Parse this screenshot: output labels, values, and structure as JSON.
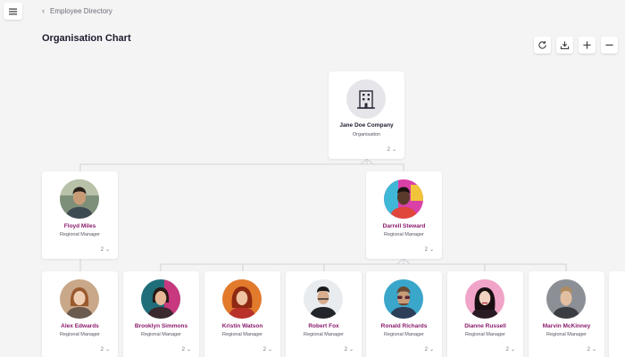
{
  "header": {
    "back_label": "Employee Directory",
    "title": "Organisation Chart"
  },
  "toolbar": {
    "icons": [
      "refresh-icon",
      "download-icon",
      "plus-icon",
      "minus-icon"
    ]
  },
  "root": {
    "name": "Jane Doe Company",
    "role": "Organisation",
    "count": "2"
  },
  "level1": [
    {
      "name": "Floyd Miles",
      "role": "Regional Manager",
      "count": "2"
    },
    {
      "name": "Darrell Steward",
      "role": "Regional Manager",
      "count": "2"
    }
  ],
  "level2": [
    {
      "name": "Alex Edwards",
      "role": "Regional Manager",
      "count": "2"
    },
    {
      "name": "Brooklyn Simmons",
      "role": "Regional Manager",
      "count": "2"
    },
    {
      "name": "Kristin Watson",
      "role": "Regional Manager",
      "count": "2"
    },
    {
      "name": "Robert Fox",
      "role": "Regional Manager",
      "count": "2"
    },
    {
      "name": "Ronald Richards",
      "role": "Regional Manager",
      "count": "2"
    },
    {
      "name": "Dianne Russell",
      "role": "Regional Manager",
      "count": "2"
    },
    {
      "name": "Marvin McKinney",
      "role": "Regional Manager",
      "count": "2"
    }
  ],
  "colors": {
    "name_accent": "#8a1a6b",
    "background": "#f4f4f5",
    "connector": "#c9c9cf"
  }
}
